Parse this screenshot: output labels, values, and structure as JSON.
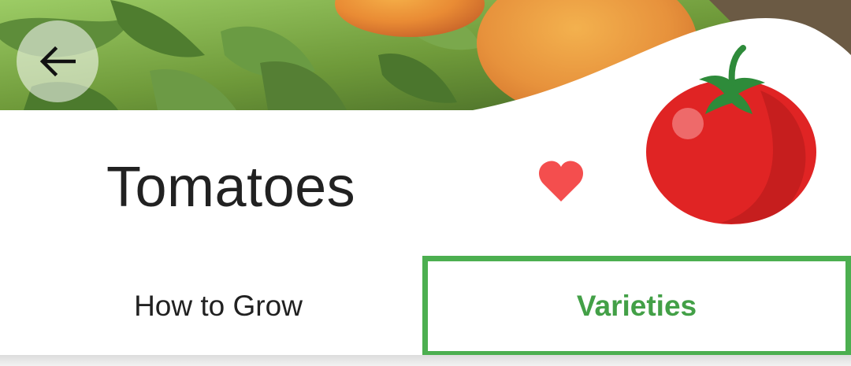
{
  "header": {
    "back_icon": "arrow-left-icon",
    "hero_image": "tomato-plant-photo"
  },
  "plant": {
    "title": "Tomatoes",
    "favorite_icon": "heart-icon",
    "favorite_color": "#f44e4e",
    "image": "tomato-illustration"
  },
  "tabs": [
    {
      "label": "How to Grow",
      "selected": false
    },
    {
      "label": "Varieties",
      "selected": true
    }
  ],
  "colors": {
    "accent": "#43a047",
    "selection_outline": "#4caf50",
    "title_text": "#212121"
  }
}
